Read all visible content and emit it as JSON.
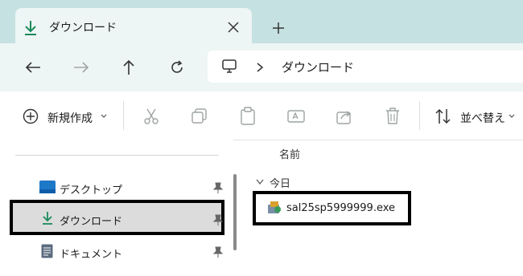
{
  "tab": {
    "title": "ダウンロード",
    "close_icon": "close-icon",
    "new_tab_icon": "plus-icon"
  },
  "address": {
    "crumbs": [
      "ダウンロード"
    ]
  },
  "toolbar": {
    "new_label": "新規作成",
    "sort_label": "並べ替え"
  },
  "sidebar": {
    "items": [
      {
        "label": "デスクトップ",
        "icon": "desktop-icon",
        "pinned": true
      },
      {
        "label": "ダウンロード",
        "icon": "download-icon",
        "pinned": true,
        "selected": true
      },
      {
        "label": "ドキュメント",
        "icon": "document-icon",
        "pinned": true
      }
    ]
  },
  "content": {
    "column_header": "名前",
    "group": "今日",
    "files": [
      {
        "name": "sal25sp5999999.exe",
        "icon": "installer-icon"
      }
    ]
  },
  "colors": {
    "titlebar": "#c6e1e1",
    "addressbar": "#eef5f5",
    "accent": "#1b8a5a"
  }
}
